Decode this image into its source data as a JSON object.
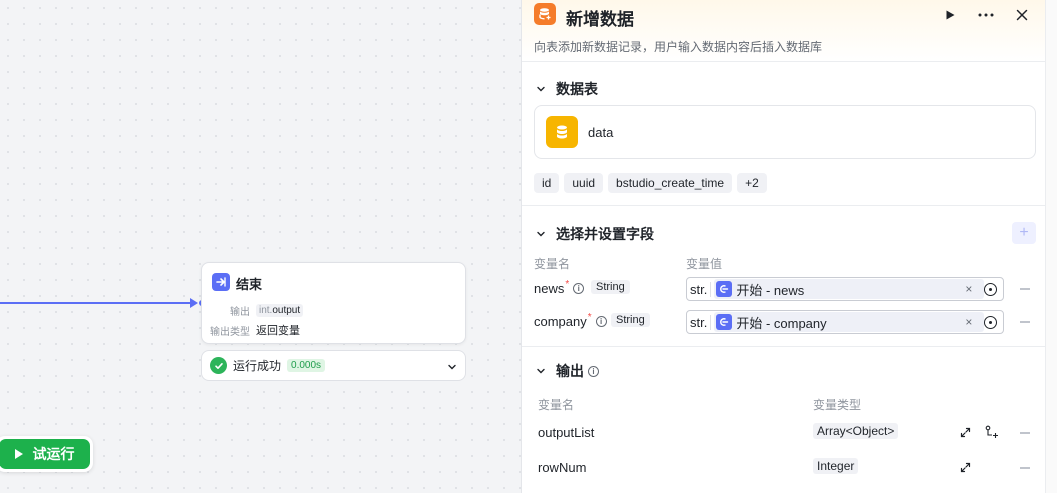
{
  "canvas": {
    "end_node": {
      "title": "结束",
      "output_label": "输出",
      "output_prefix": "int.",
      "output_value": "output",
      "output_type_label": "输出类型",
      "output_type_value": "返回变量"
    },
    "run_status": {
      "text": "运行成功",
      "time": "0.000s"
    },
    "try_run_label": "试运行"
  },
  "panel": {
    "title": "新增数据",
    "description": "向表添加新数据记录，用户输入数据内容后插入数据库",
    "table_section": {
      "title": "数据表",
      "table_name": "data",
      "fields": [
        "id",
        "uuid",
        "bstudio_create_time",
        "+2"
      ]
    },
    "fields_section": {
      "title": "选择并设置字段",
      "add_label": "+",
      "col_name": "变量名",
      "col_value": "变量值",
      "rows": [
        {
          "name": "news",
          "required": "*",
          "type": "String",
          "str_label": "str.",
          "value": "开始 - news",
          "clear": "×"
        },
        {
          "name": "company",
          "required": "*",
          "type": "String",
          "str_label": "str.",
          "value": "开始 - company",
          "clear": "×"
        }
      ]
    },
    "output_section": {
      "title": "输出",
      "col_name": "变量名",
      "col_type": "变量类型",
      "rows": [
        {
          "name": "outputList",
          "type": "Array<Object>"
        },
        {
          "name": "rowNum",
          "type": "Integer"
        }
      ]
    }
  },
  "colors": {
    "accent": "#5b6ef5",
    "success": "#1db14c",
    "db_badge": "#f57c2a",
    "table_icon": "#f7b500",
    "required": "#f54a45"
  },
  "icons": [
    "database-icon",
    "play-icon",
    "more-icon",
    "close-icon",
    "chevron-down-icon",
    "info-icon",
    "check-icon",
    "expand-icon",
    "add-child-icon",
    "target-icon"
  ]
}
